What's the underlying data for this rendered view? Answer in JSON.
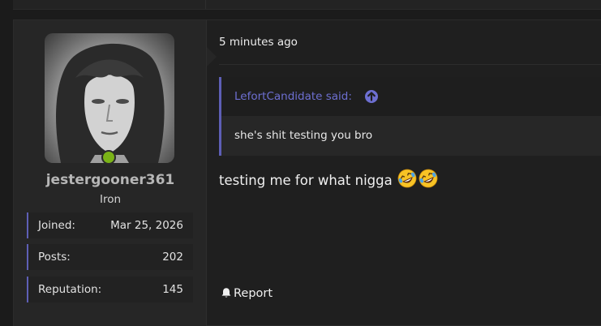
{
  "post": {
    "timestamp": "5 minutes ago",
    "message": "testing me for what nigga",
    "emojis": [
      "rolling-on-floor-laughing-emoji",
      "rolling-on-floor-laughing-emoji"
    ],
    "report_label": "Report"
  },
  "user": {
    "username": "jestergooner361",
    "rank": "Iron",
    "online": true,
    "stats": [
      {
        "label": "Joined:",
        "value": "Mar 25, 2026"
      },
      {
        "label": "Posts:",
        "value": "202"
      },
      {
        "label": "Reputation:",
        "value": "145"
      }
    ]
  },
  "quote": {
    "author": "LefortCandidate said:",
    "text": "she's shit testing you bro"
  },
  "colors": {
    "accent": "#5e5fb6",
    "link": "#6d6fd1",
    "online": "#7ab317",
    "background": "#1b1b1b"
  }
}
